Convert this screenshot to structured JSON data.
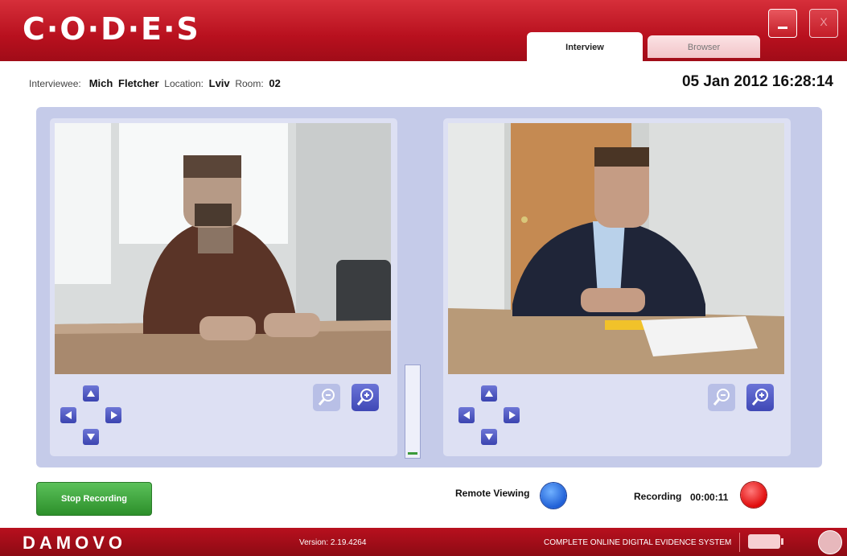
{
  "app": {
    "logo_text": "C·O·D·E·S",
    "tabs": [
      {
        "label": "Interview",
        "active": true
      },
      {
        "label": "Browser",
        "active": false
      }
    ],
    "window_controls": {
      "minimize_label": "_",
      "close_label": "X"
    }
  },
  "info": {
    "interviewee_label": "Interviewee:",
    "interviewee_first": "Mich",
    "interviewee_last": "Fletcher",
    "location_label": "Location:",
    "location": "Lviv",
    "room_label": "Room:",
    "room": "02",
    "datetime": "05 Jan 2012 16:28:14"
  },
  "controls": {
    "stop_recording_label": "Stop Recording",
    "remote_viewing_label": "Remote Viewing",
    "recording_label": "Recording",
    "recording_time": "00:00:11"
  },
  "footer": {
    "brand": "DAMOVO",
    "version": "Version: 2.19.4264",
    "tagline": "COMPLETE ONLINE DIGITAL EVIDENCE SYSTEM"
  },
  "audio_level": 0.03,
  "colors": {
    "header_red": "#b8101e",
    "panel_blue": "#c5cbe9",
    "stop_green": "#2c8f2a",
    "remote_blue": "#1f5fd6",
    "record_red": "#e00a0a"
  }
}
